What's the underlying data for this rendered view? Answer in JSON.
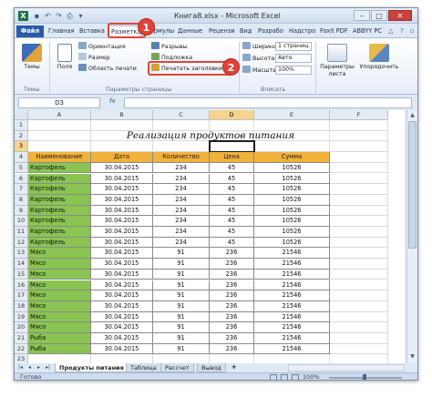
{
  "window": {
    "title": "Книга8.xlsx - Microsoft Excel",
    "app_icon": "excel-icon",
    "qat": [
      "save-icon",
      "undo-icon",
      "redo-icon",
      "print-icon",
      "customize-icon"
    ]
  },
  "tabs": [
    {
      "label": "Файл"
    },
    {
      "label": "Главная"
    },
    {
      "label": "Вставка"
    },
    {
      "label": "Разметка"
    },
    {
      "label": "Формулы"
    },
    {
      "label": "Данные"
    },
    {
      "label": "Рецензи"
    },
    {
      "label": "Вид"
    },
    {
      "label": "Разрабо"
    },
    {
      "label": "Надстро"
    },
    {
      "label": "Foxit PDF"
    },
    {
      "label": "ABBYY PC"
    }
  ],
  "ribbon": {
    "themes": {
      "btn": "Темы",
      "group": "Темы"
    },
    "page_setup": {
      "margins": "Поля",
      "orientation": "Ориентация",
      "size": "Размер",
      "print_area": "Область печати",
      "breaks": "Разрывы",
      "background": "Подложка",
      "print_titles": "Печатать заголовки",
      "group": "Параметры страницы"
    },
    "fit": {
      "width_label": "Ширина:",
      "width_value": "1 страниц",
      "height_label": "Высота:",
      "height_value": "Авто",
      "scale_label": "Масштаб:",
      "scale_value": "100%",
      "group": "Вписать"
    },
    "sheet_options": {
      "btn": "Параметры листа"
    },
    "arrange": {
      "btn": "Упорядочить"
    }
  },
  "callouts": [
    "1",
    "2"
  ],
  "formula_bar": {
    "name_box": "D3",
    "fx": "fx",
    "content": ""
  },
  "columns": [
    "A",
    "B",
    "C",
    "D",
    "E",
    "F"
  ],
  "rows": [
    "1",
    "2",
    "3",
    "4",
    "5",
    "6",
    "7",
    "8",
    "9",
    "10",
    "11",
    "12",
    "13",
    "14",
    "15",
    "16",
    "17",
    "18",
    "19",
    "20",
    "21",
    "22",
    "23"
  ],
  "sheet_title": "Реализация продуктов питания",
  "table": {
    "headers": [
      "Наименование",
      "Дата",
      "Количество",
      "Цена",
      "Сумма"
    ],
    "rows": [
      [
        "Картофель",
        "30.04.2015",
        "234",
        "45",
        "10526"
      ],
      [
        "Картофель",
        "30.04.2015",
        "234",
        "45",
        "10526"
      ],
      [
        "Картофель",
        "30.04.2015",
        "234",
        "45",
        "10526"
      ],
      [
        "Картофель",
        "30.04.2015",
        "234",
        "45",
        "10526"
      ],
      [
        "Картофель",
        "30.04.2015",
        "234",
        "45",
        "10526"
      ],
      [
        "Картофель",
        "30.04.2015",
        "234",
        "45",
        "10526"
      ],
      [
        "Картофель",
        "30.04.2015",
        "234",
        "45",
        "10526"
      ],
      [
        "Картофель",
        "30.04.2015",
        "234",
        "45",
        "10526"
      ],
      [
        "Мясо",
        "30.04.2015",
        "91",
        "236",
        "21546"
      ],
      [
        "Мясо",
        "30.04.2015",
        "91",
        "236",
        "21546"
      ],
      [
        "Мясо",
        "30.04.2015",
        "91",
        "236",
        "21546"
      ],
      [
        "Мясо",
        "30.04.2015",
        "91",
        "236",
        "21546"
      ],
      [
        "Мясо",
        "30.04.2015",
        "91",
        "236",
        "21546"
      ],
      [
        "Мясо",
        "30.04.2015",
        "91",
        "236",
        "21546"
      ],
      [
        "Мясо",
        "30.04.2015",
        "91",
        "236",
        "21546"
      ],
      [
        "Мясо",
        "30.04.2015",
        "91",
        "236",
        "21546"
      ],
      [
        "Рыба",
        "30.04.2015",
        "91",
        "236",
        "21546"
      ],
      [
        "Рыба",
        "30.04.2015",
        "91",
        "236",
        "21546"
      ]
    ]
  },
  "sheets": [
    "Продукты питания",
    "Таблица",
    "Рассчет",
    "Вывод"
  ],
  "status": {
    "ready": "Готово",
    "zoom": "100%"
  },
  "colors": {
    "header_fill": "#f1b23b",
    "name_fill": "#8ac452",
    "callout": "#e0433a",
    "file_tab": "#2a5ba8"
  }
}
